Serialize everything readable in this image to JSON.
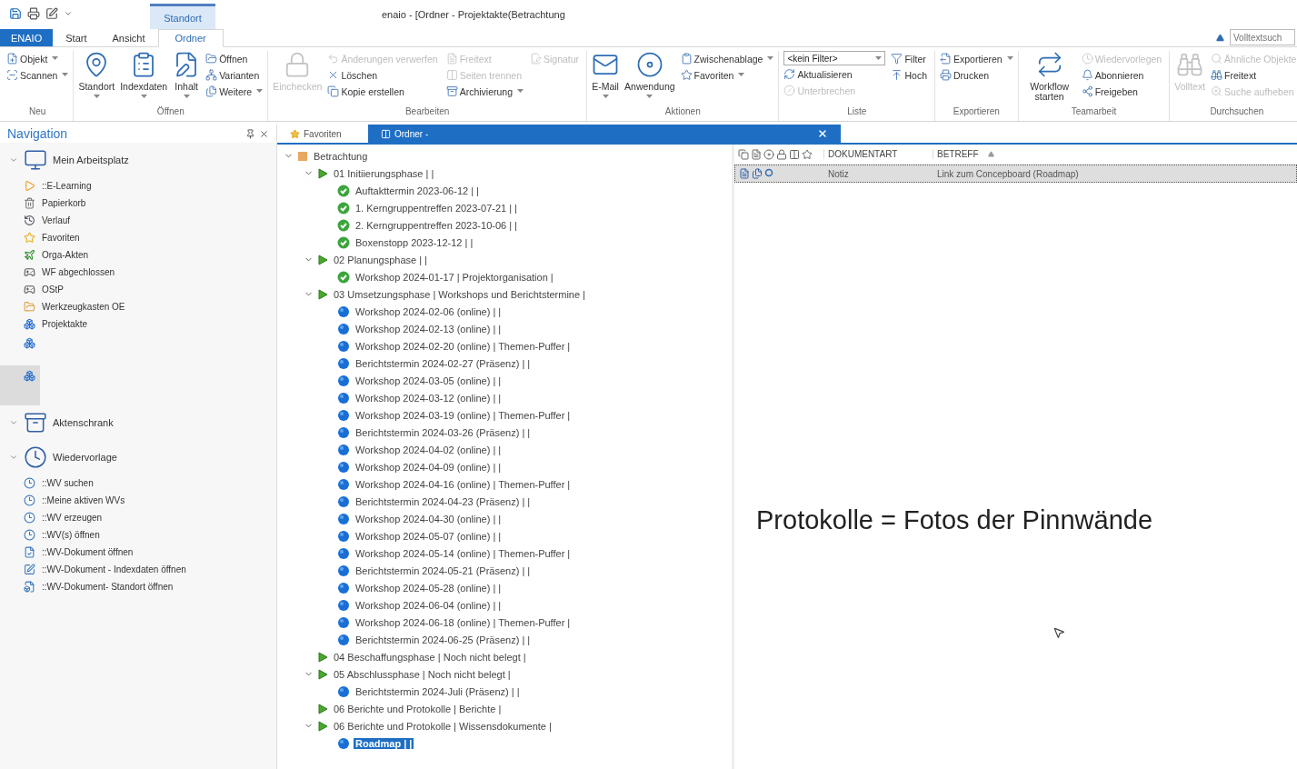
{
  "window": {
    "title": "enaio  - [Ordner - Projektakte(Betrachtung",
    "contextual_group": "Standort"
  },
  "ribbon_tabs": [
    {
      "label": "ENAIO",
      "kind": "file",
      "selected": false
    },
    {
      "label": "Start",
      "kind": "tab",
      "selected": false
    },
    {
      "label": "Ansicht",
      "kind": "tab",
      "selected": false
    },
    {
      "label": "Ordner",
      "kind": "tab",
      "selected": true
    }
  ],
  "fulltext_search": {
    "placeholder": "Volltextsuch"
  },
  "ribbon_groups": [
    {
      "label": "Neu",
      "columns": [
        [
          {
            "label": "Objekt",
            "kind": "small",
            "dropdown": true,
            "disabled": false
          },
          {
            "label": "Scannen",
            "kind": "small",
            "dropdown": true,
            "disabled": false
          }
        ]
      ]
    },
    {
      "label": "Öffnen",
      "columns": [
        [
          {
            "label": "Standort",
            "kind": "large",
            "dropdown": true,
            "disabled": false
          }
        ],
        [
          {
            "label": "Indexdaten",
            "kind": "large",
            "dropdown": true,
            "disabled": false
          }
        ],
        [
          {
            "label": "Inhalt",
            "kind": "large",
            "dropdown": true,
            "disabled": false
          }
        ],
        [
          {
            "label": "Öffnen",
            "kind": "small",
            "dropdown": false,
            "disabled": false
          },
          {
            "label": "Varianten",
            "kind": "small",
            "dropdown": false,
            "disabled": false
          },
          {
            "label": "Weitere",
            "kind": "small",
            "dropdown": true,
            "disabled": false
          }
        ]
      ]
    },
    {
      "label": "Bearbeiten",
      "columns": [
        [
          {
            "label": "Einchecken",
            "kind": "large",
            "dropdown": false,
            "disabled": true
          }
        ],
        [
          {
            "label": "Änderungen verwerfen",
            "kind": "small",
            "dropdown": false,
            "disabled": true
          },
          {
            "label": "Löschen",
            "kind": "small",
            "dropdown": false,
            "disabled": false
          },
          {
            "label": "Kopie erstellen",
            "kind": "small",
            "dropdown": false,
            "disabled": false
          }
        ],
        [
          {
            "label": "Freitext",
            "kind": "small",
            "dropdown": false,
            "disabled": true
          },
          {
            "label": "Seiten trennen",
            "kind": "small",
            "dropdown": false,
            "disabled": true
          },
          {
            "label": "Archivierung",
            "kind": "small",
            "dropdown": true,
            "disabled": false
          }
        ],
        [
          {
            "label": "Signatur",
            "kind": "small",
            "dropdown": false,
            "disabled": true
          }
        ]
      ]
    },
    {
      "label": "Aktionen",
      "columns": [
        [
          {
            "label": "E-Mail",
            "kind": "large",
            "dropdown": true,
            "disabled": false
          }
        ],
        [
          {
            "label": "Anwendung",
            "kind": "large",
            "dropdown": true,
            "disabled": false
          }
        ],
        [
          {
            "label": "Zwischenablage",
            "kind": "small",
            "dropdown": true,
            "disabled": false
          },
          {
            "label": "Favoriten",
            "kind": "small",
            "dropdown": true,
            "disabled": false
          }
        ]
      ]
    },
    {
      "label": "Liste",
      "columns": [
        [
          {
            "label": "<kein Filter>",
            "kind": "combo",
            "dropdown": true,
            "disabled": false
          },
          {
            "label": "Aktualisieren",
            "kind": "small",
            "dropdown": false,
            "disabled": false
          },
          {
            "label": "Unterbrechen",
            "kind": "small",
            "dropdown": false,
            "disabled": true
          }
        ],
        [
          {
            "label": "Filter",
            "kind": "small",
            "dropdown": false,
            "disabled": false
          },
          {
            "label": "Hoch",
            "kind": "small",
            "dropdown": false,
            "disabled": false
          }
        ]
      ]
    },
    {
      "label": "Exportieren",
      "columns": [
        [
          {
            "label": "Exportieren",
            "kind": "small",
            "dropdown": true,
            "disabled": false
          },
          {
            "label": "Drucken",
            "kind": "small",
            "dropdown": false,
            "disabled": false
          }
        ]
      ]
    },
    {
      "label": "Teamarbeit",
      "columns": [
        [
          {
            "label": "Workflow starten",
            "kind": "large",
            "dropdown": false,
            "disabled": false
          }
        ],
        [
          {
            "label": "Wiedervorlegen",
            "kind": "small",
            "dropdown": false,
            "disabled": true
          },
          {
            "label": "Abonnieren",
            "kind": "small",
            "dropdown": false,
            "disabled": false
          },
          {
            "label": "Freigeben",
            "kind": "small",
            "dropdown": false,
            "disabled": false
          }
        ]
      ]
    },
    {
      "label": "Durchsuchen",
      "columns": [
        [
          {
            "label": "Volltext",
            "kind": "large",
            "dropdown": false,
            "disabled": true
          }
        ],
        [
          {
            "label": "Ähnliche Objekte",
            "kind": "small",
            "dropdown": false,
            "disabled": true
          },
          {
            "label": "Freitext",
            "kind": "small",
            "dropdown": false,
            "disabled": false
          },
          {
            "label": "Suche aufheben",
            "kind": "small",
            "dropdown": false,
            "disabled": true
          }
        ]
      ]
    }
  ],
  "navigation": {
    "title": "Navigation",
    "sections": [
      {
        "title": "Mein Arbeitsplatz",
        "expanded": true,
        "items": [
          "::E-Learning",
          "Papierkorb",
          "Verlauf",
          "Favoriten",
          "Orga-Akten",
          "WF abgechlossen",
          "OStP",
          "Werkzeugkasten OE",
          "Projektakte"
        ],
        "unlabeled_items": [
          {
            "selected": false
          },
          {
            "selected": true
          }
        ]
      },
      {
        "title": "Aktenschrank",
        "expanded": true
      },
      {
        "title": "Wiedervorlage",
        "expanded": true,
        "items": [
          "::WV suchen",
          "::Meine aktiven WVs",
          "::WV erzeugen",
          "::WV(s) öffnen",
          "::WV-Dokument öffnen",
          "::WV-Dokument - Indexdaten öffnen",
          "::WV-Dokument-  Standort öffnen"
        ]
      }
    ]
  },
  "doc_tabs": [
    {
      "label": "Favoriten",
      "selected": false
    },
    {
      "label": "Ordner -",
      "selected": true
    }
  ],
  "tree": [
    {
      "label": "Betrachtung",
      "kind": "folder",
      "expanded": true,
      "selected": false,
      "children": [
        {
          "label": "01 Initiierungsphase | |",
          "kind": "phase",
          "expanded": true,
          "selected": false,
          "children": [
            {
              "label": "Auftakttermin 2023-06-12 | |",
              "kind": "done",
              "selected": false
            },
            {
              "label": "1. Kerngruppentreffen 2023-07-21 | |",
              "kind": "done",
              "selected": false
            },
            {
              "label": "2. Kerngruppentreffen 2023-10-06 | |",
              "kind": "done",
              "selected": false
            },
            {
              "label": "Boxenstopp 2023-12-12 | |",
              "kind": "done",
              "selected": false
            }
          ]
        },
        {
          "label": "02 Planungsphase | |",
          "kind": "phase",
          "expanded": true,
          "selected": false,
          "children": [
            {
              "label": "Workshop 2024-01-17 | Projektorganisation |",
              "kind": "done",
              "selected": false
            }
          ]
        },
        {
          "label": "03 Umsetzungsphase | Workshops und Berichtstermine |",
          "kind": "phase",
          "expanded": true,
          "selected": false,
          "children": [
            {
              "label": "Workshop 2024-02-06 (online) | |",
              "kind": "open",
              "selected": false
            },
            {
              "label": "Workshop 2024-02-13 (online) | |",
              "kind": "open",
              "selected": false
            },
            {
              "label": "Workshop 2024-02-20 (online) | Themen-Puffer |",
              "kind": "open",
              "selected": false
            },
            {
              "label": "Berichtstermin 2024-02-27 (Präsenz) | |",
              "kind": "open",
              "selected": false
            },
            {
              "label": "Workshop 2024-03-05 (online) | |",
              "kind": "open",
              "selected": false
            },
            {
              "label": "Workshop 2024-03-12 (online) | |",
              "kind": "open",
              "selected": false
            },
            {
              "label": "Workshop 2024-03-19 (online) | Themen-Puffer |",
              "kind": "open",
              "selected": false
            },
            {
              "label": "Berichtstermin 2024-03-26 (Präsenz) | |",
              "kind": "open",
              "selected": false
            },
            {
              "label": "Workshop 2024-04-02 (online) | |",
              "kind": "open",
              "selected": false
            },
            {
              "label": "Workshop 2024-04-09 (online) | |",
              "kind": "open",
              "selected": false
            },
            {
              "label": "Workshop 2024-04-16 (online) | Themen-Puffer |",
              "kind": "open",
              "selected": false
            },
            {
              "label": "Berichtstermin 2024-04-23 (Präsenz) | |",
              "kind": "open",
              "selected": false
            },
            {
              "label": "Workshop 2024-04-30 (online) | |",
              "kind": "open",
              "selected": false
            },
            {
              "label": "Workshop 2024-05-07 (online) | |",
              "kind": "open",
              "selected": false
            },
            {
              "label": "Workshop 2024-05-14 (online) | Themen-Puffer |",
              "kind": "open",
              "selected": false
            },
            {
              "label": "Berichtstermin 2024-05-21 (Präsenz) | |",
              "kind": "open",
              "selected": false
            },
            {
              "label": "Workshop 2024-05-28 (online) | |",
              "kind": "open",
              "selected": false
            },
            {
              "label": "Workshop 2024-06-04 (online) | |",
              "kind": "open",
              "selected": false
            },
            {
              "label": "Workshop 2024-06-18 (online) | Themen-Puffer |",
              "kind": "open",
              "selected": false
            },
            {
              "label": "Berichtstermin 2024-06-25 (Präsenz) | |",
              "kind": "open",
              "selected": false
            }
          ]
        },
        {
          "label": "04 Beschaffungsphase | Noch nicht belegt |",
          "kind": "phase",
          "expanded": false,
          "selected": false
        },
        {
          "label": "05 Abschlussphase | Noch nicht belegt |",
          "kind": "phase",
          "expanded": true,
          "selected": false,
          "children": [
            {
              "label": "Berichtstermin 2024-Juli (Präsenz) | |",
              "kind": "open",
              "selected": false
            }
          ]
        },
        {
          "label": "06 Berichte und Protokolle | Berichte |",
          "kind": "phase",
          "expanded": false,
          "selected": false
        },
        {
          "label": "06 Berichte und Protokolle | Wissensdokumente |",
          "kind": "phase",
          "expanded": true,
          "selected": false,
          "children": [
            {
              "label": "Roadmap |  |",
              "kind": "open",
              "selected": true
            }
          ]
        }
      ]
    }
  ],
  "document_list": {
    "columns": [
      {
        "label": "DOKUMENTART",
        "sorted": false
      },
      {
        "label": "BETREFF",
        "sorted": true
      }
    ],
    "rows": [
      {
        "cells": [
          "Notiz",
          "Link zum Concepboard (Roadmap)"
        ],
        "selected": true
      }
    ]
  },
  "preview_text": "Protokolle = Fotos der Pinnwände"
}
